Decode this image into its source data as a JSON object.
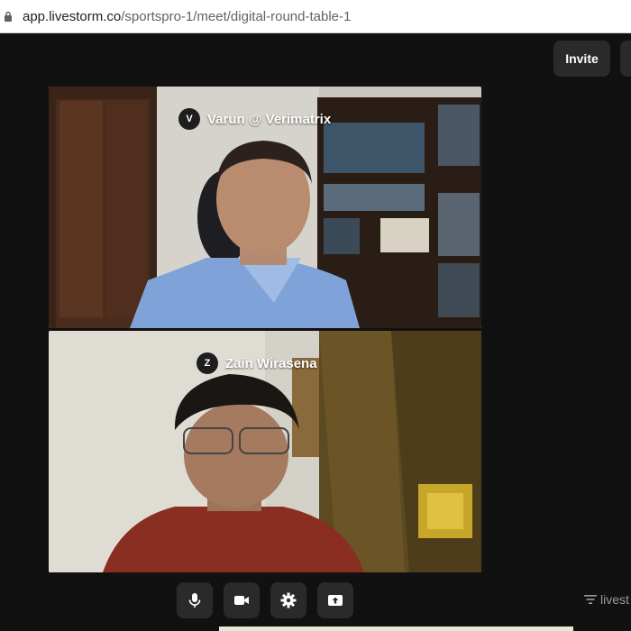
{
  "browser": {
    "url_domain": "app.livestorm.co",
    "url_path": "/sportspro-1/meet/digital-round-table-1"
  },
  "header": {
    "invite_label": "Invite"
  },
  "participants": [
    {
      "initial": "V",
      "name": "Varun @ Verimatrix"
    },
    {
      "initial": "Z",
      "name": "Zain Wirasena"
    }
  ],
  "controls": {
    "icons": [
      "microphone-icon",
      "camera-icon",
      "settings-icon",
      "share-screen-icon"
    ]
  },
  "footer": {
    "brand_text": "livest"
  }
}
